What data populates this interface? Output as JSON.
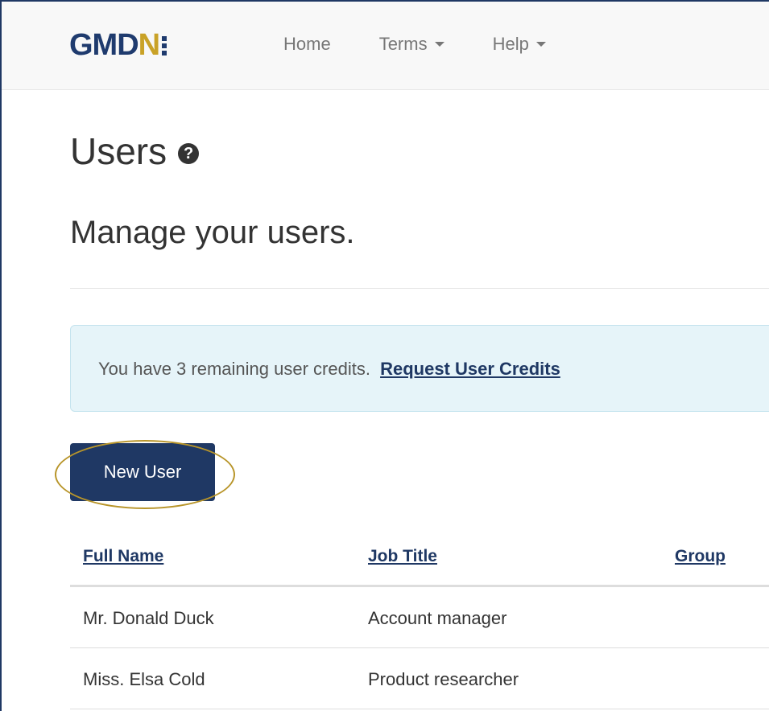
{
  "brand": {
    "logo_text_main": "GMD",
    "logo_text_accent": "N",
    "colors": {
      "primary": "#1f3b6e",
      "accent": "#c9a227"
    }
  },
  "nav": {
    "items": [
      {
        "label": "Home",
        "dropdown": false
      },
      {
        "label": "Terms",
        "dropdown": true
      },
      {
        "label": "Help",
        "dropdown": true
      }
    ]
  },
  "page": {
    "title": "Users",
    "title_icon": "question-circle-icon",
    "subtitle": "Manage your users."
  },
  "alert": {
    "text": "You have 3 remaining user credits.",
    "link": "Request User Credits"
  },
  "actions": {
    "new_user_label": "New User",
    "highlight_color": "#b8952a"
  },
  "table": {
    "headers": [
      "Full Name",
      "Job Title",
      "Group"
    ],
    "rows": [
      [
        "Mr. Donald Duck",
        "Account manager",
        ""
      ],
      [
        "Miss. Elsa Cold",
        "Product researcher",
        ""
      ]
    ]
  }
}
